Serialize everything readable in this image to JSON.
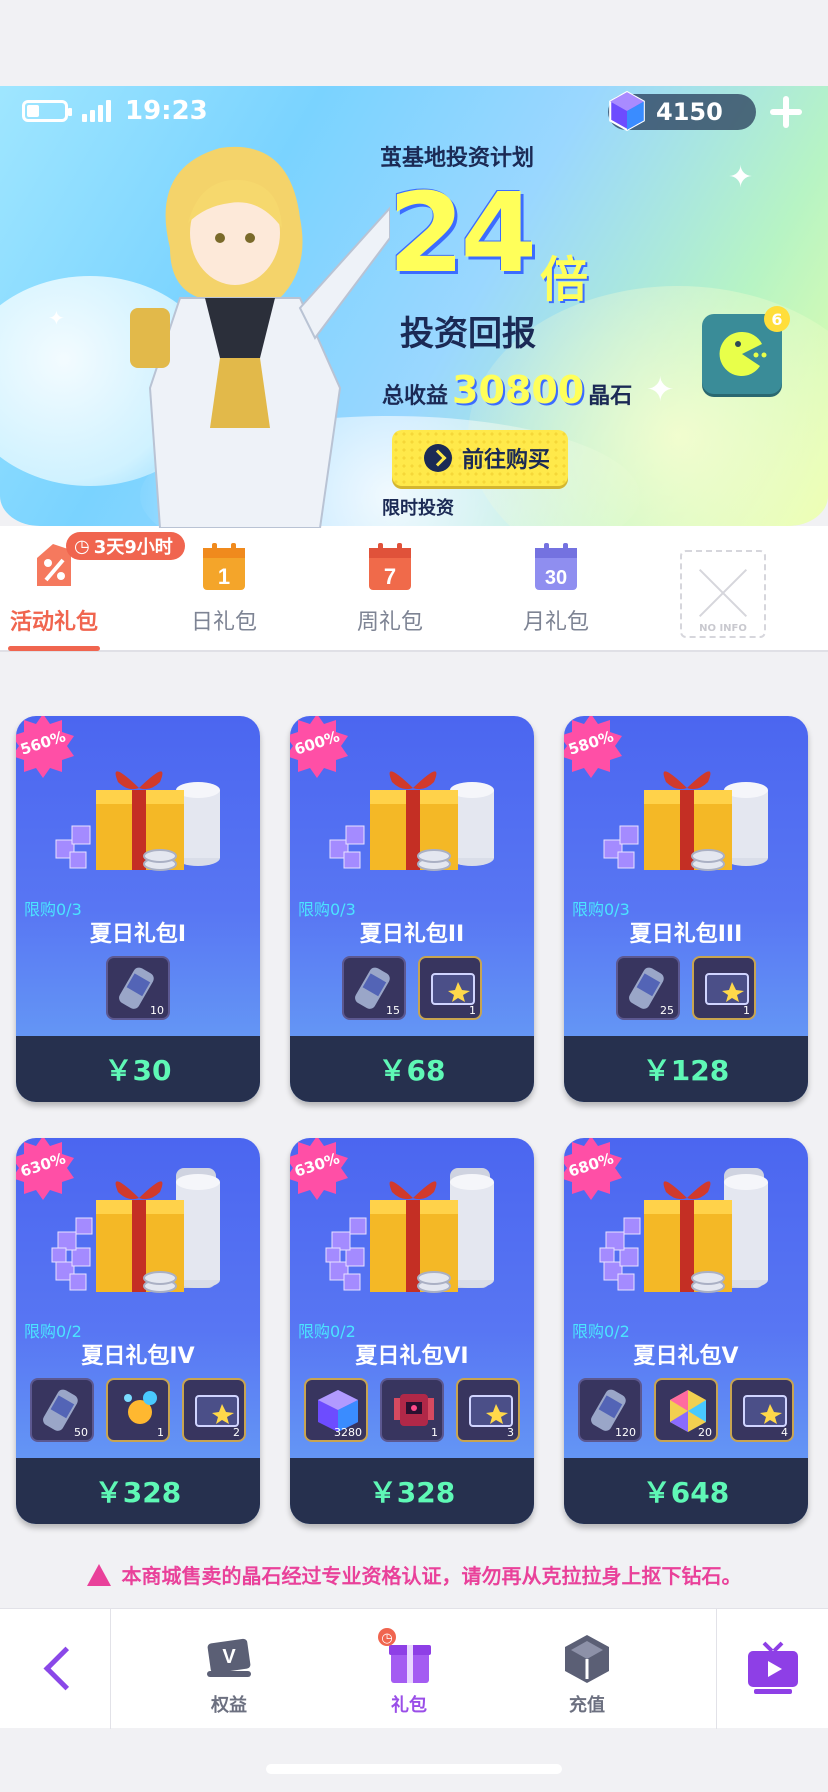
{
  "status_bar": {
    "time": "19:23"
  },
  "currency": {
    "gems": "4150"
  },
  "banner": {
    "subtitle": "茧基地投资计划",
    "multiplier": "24",
    "multiplier_unit": "倍",
    "headline": "投资回报",
    "total_prefix": "总收益",
    "total_value": "30800",
    "total_suffix": "晶石",
    "buy_button": "前往购买",
    "limited_text": "限时投资",
    "mascot_badge": "6"
  },
  "tabs": {
    "timer": "3天9小时",
    "items": [
      {
        "label": "活动礼包",
        "icon": "percent-tag-icon",
        "active": true
      },
      {
        "label": "日礼包",
        "icon": "calendar-1-icon",
        "num": "1"
      },
      {
        "label": "周礼包",
        "icon": "calendar-7-icon",
        "num": "7"
      },
      {
        "label": "月礼包",
        "icon": "calendar-30-icon",
        "num": "30"
      }
    ],
    "placeholder_text": "NO INFO"
  },
  "packs": [
    {
      "badge": "560%",
      "limit": "限购0/3",
      "name": "夏日礼包I",
      "price": "￥30",
      "items": [
        {
          "type": "ticket",
          "count": "10"
        }
      ]
    },
    {
      "badge": "600%",
      "limit": "限购0/3",
      "name": "夏日礼包II",
      "price": "￥68",
      "items": [
        {
          "type": "ticket",
          "count": "15"
        },
        {
          "type": "card",
          "count": "1"
        }
      ]
    },
    {
      "badge": "580%",
      "limit": "限购0/3",
      "name": "夏日礼包III",
      "price": "￥128",
      "items": [
        {
          "type": "ticket",
          "count": "25"
        },
        {
          "type": "card",
          "count": "1"
        }
      ]
    },
    {
      "badge": "630%",
      "limit": "限购0/2",
      "name": "夏日礼包IV",
      "price": "￥328",
      "items": [
        {
          "type": "ticket",
          "count": "50"
        },
        {
          "type": "orb",
          "count": "1"
        },
        {
          "type": "card",
          "count": "2"
        }
      ]
    },
    {
      "badge": "630%",
      "limit": "限购0/2",
      "name": "夏日礼包VI",
      "price": "￥328",
      "items": [
        {
          "type": "gem",
          "count": "3280"
        },
        {
          "type": "robot",
          "count": "1"
        },
        {
          "type": "card",
          "count": "3"
        }
      ]
    },
    {
      "badge": "680%",
      "limit": "限购0/2",
      "name": "夏日礼包V",
      "price": "￥648",
      "items": [
        {
          "type": "ticket",
          "count": "120"
        },
        {
          "type": "prism",
          "count": "20"
        },
        {
          "type": "card",
          "count": "4"
        }
      ]
    }
  ],
  "notice": "本商城售卖的晶石经过专业资格认证，请勿再从克拉拉身上抠下钻石。",
  "bottom_nav": {
    "items": [
      {
        "label": "权益",
        "icon": "vip-card-icon"
      },
      {
        "label": "礼包",
        "icon": "gift-icon",
        "active": true
      },
      {
        "label": "充值",
        "icon": "cube-icon"
      }
    ]
  },
  "colors": {
    "accent": "#f0654f",
    "price": "#5ff8b6",
    "notice": "#e9419a",
    "nav_active": "#9a4ee8"
  }
}
